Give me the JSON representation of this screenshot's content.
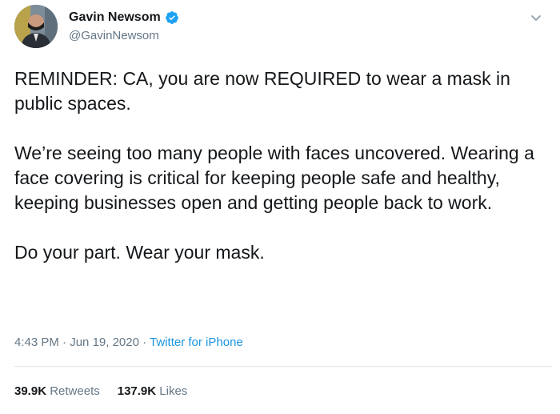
{
  "author": {
    "name": "Gavin Newsom",
    "handle": "@GavinNewsom",
    "verified": true
  },
  "tweet": {
    "paragraphs": [
      "REMINDER: CA, you are now REQUIRED to wear a mask in public spaces.",
      "We’re seeing too many people with faces uncovered. Wearing a face covering is critical for keeping people safe and healthy, keeping businesses open and getting people back to work.",
      "Do your part. Wear your mask."
    ],
    "time": "4:43 PM",
    "date": "Jun 19, 2020",
    "separator": "·",
    "source": "Twitter for iPhone"
  },
  "stats": {
    "retweets_count": "39.9K",
    "retweets_label": "Retweets",
    "likes_count": "137.9K",
    "likes_label": "Likes"
  },
  "colors": {
    "text": "#14171a",
    "muted": "#657786",
    "link": "#1b95e0",
    "verified": "#1da1f2"
  },
  "icons": {
    "verified": "verified-badge-icon",
    "menu": "chevron-down-icon"
  }
}
